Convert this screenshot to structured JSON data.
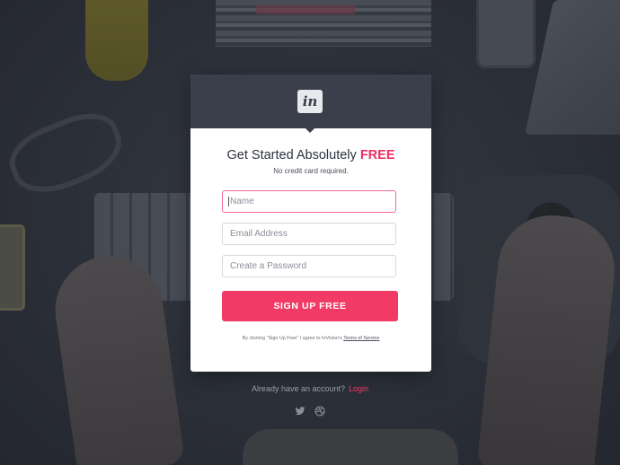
{
  "brand": {
    "logo_text": "in"
  },
  "signup": {
    "title_prefix": "Get Started Absolutely ",
    "title_highlight": "FREE",
    "subtitle": "No credit card required.",
    "fields": {
      "name_placeholder": "Name",
      "email_placeholder": "Email Address",
      "password_placeholder": "Create a Password"
    },
    "submit_label": "SIGN UP FREE",
    "terms_prefix": "By clicking \"Sign Up Free\" I agree to InVision's ",
    "terms_link": "Terms of Service"
  },
  "footer": {
    "account_prompt": "Already have an account?",
    "login_label": "Login",
    "social_icons": [
      "twitter-icon",
      "dribbble-icon"
    ]
  },
  "colors": {
    "accent": "#f23a66",
    "header": "#3a3f4b",
    "background": "#2a2e37"
  }
}
